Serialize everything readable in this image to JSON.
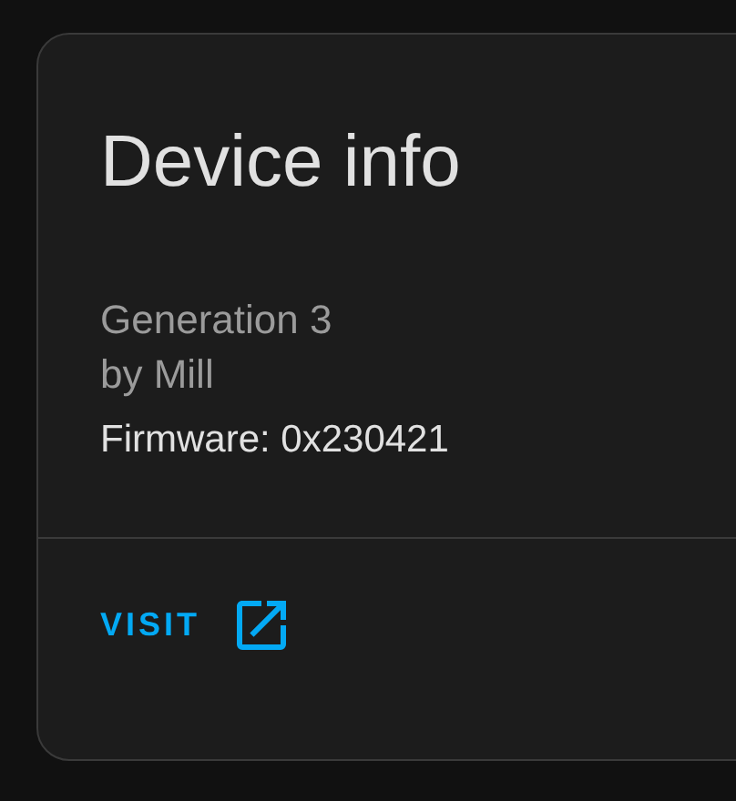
{
  "card": {
    "title": "Device info",
    "subtitle_lines": [
      "Generation 3",
      "by Mill"
    ],
    "details": [
      "Firmware: 0x230421"
    ],
    "actions": [
      {
        "label": "VISIT",
        "kind": "external_link"
      }
    ]
  }
}
